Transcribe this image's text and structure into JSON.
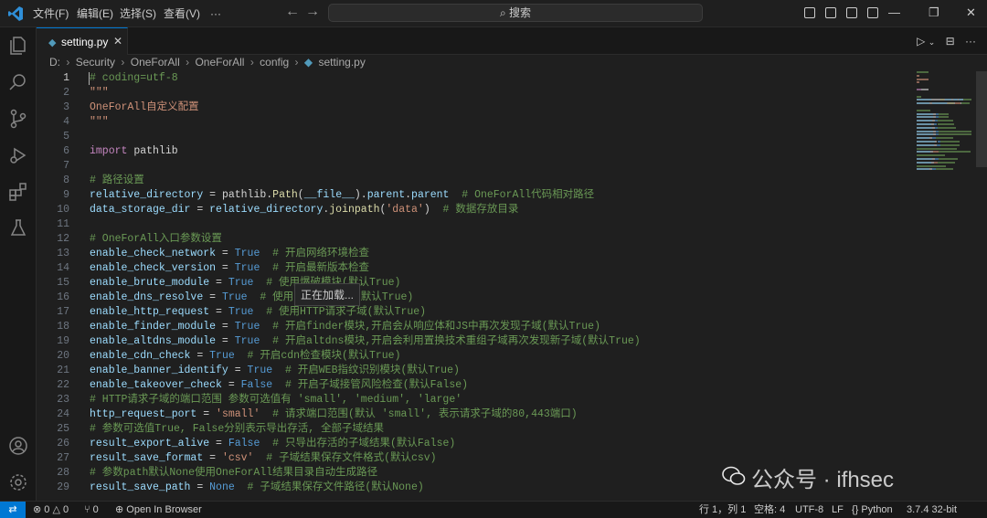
{
  "menu": [
    "文件(F)",
    "编辑(E)",
    "选择(S)",
    "查看(V)",
    "···"
  ],
  "search_label": "搜索",
  "tab": {
    "label": "setting.py",
    "close": "✕"
  },
  "breadcrumb": [
    "D:",
    "Security",
    "OneForAll",
    "OneForAll",
    "config",
    "setting.py"
  ],
  "tooltip": "正在加载...",
  "watermark": "公众号 · ifhsec",
  "status": {
    "errors": "0",
    "warnings": "0",
    "ports": "0",
    "open_browser": "Open In Browser",
    "position": "行 1，列 1",
    "spaces": "空格: 4",
    "encoding": "UTF-8",
    "eol": "LF",
    "language": "Python",
    "interpreter": "3.7.4 32-bit"
  },
  "code_lines": [
    {
      "n": "1",
      "t": [
        [
          "cm",
          "# coding=utf-8"
        ]
      ]
    },
    {
      "n": "2",
      "t": [
        [
          "str",
          "\"\"\""
        ]
      ]
    },
    {
      "n": "3",
      "t": [
        [
          "str",
          "OneForAll自定义配置"
        ]
      ]
    },
    {
      "n": "4",
      "t": [
        [
          "str",
          "\"\"\""
        ]
      ]
    },
    {
      "n": "5",
      "t": []
    },
    {
      "n": "6",
      "t": [
        [
          "kw",
          "import"
        ],
        [
          "id",
          " pathlib"
        ]
      ]
    },
    {
      "n": "7",
      "t": []
    },
    {
      "n": "8",
      "t": [
        [
          "cm",
          "# 路径设置"
        ]
      ]
    },
    {
      "n": "9",
      "t": [
        [
          "var",
          "relative_directory"
        ],
        [
          "op",
          " = "
        ],
        [
          "id",
          "pathlib"
        ],
        [
          "op",
          "."
        ],
        [
          "fn",
          "Path"
        ],
        [
          "op",
          "("
        ],
        [
          "var",
          "__file__"
        ],
        [
          "op",
          ")."
        ],
        [
          "var",
          "parent"
        ],
        [
          "op",
          "."
        ],
        [
          "var",
          "parent"
        ],
        [
          "cm",
          "  # OneForAll代码相对路径"
        ]
      ]
    },
    {
      "n": "10",
      "t": [
        [
          "var",
          "data_storage_dir"
        ],
        [
          "op",
          " = "
        ],
        [
          "var",
          "relative_directory"
        ],
        [
          "op",
          "."
        ],
        [
          "fn",
          "joinpath"
        ],
        [
          "op",
          "("
        ],
        [
          "str",
          "'data'"
        ],
        [
          "op",
          ")"
        ],
        [
          "cm",
          "  # 数据存放目录"
        ]
      ]
    },
    {
      "n": "11",
      "t": []
    },
    {
      "n": "12",
      "t": [
        [
          "cm",
          "# OneForAll入口参数设置"
        ]
      ]
    },
    {
      "n": "13",
      "t": [
        [
          "var",
          "enable_check_network"
        ],
        [
          "op",
          " = "
        ],
        [
          "bool",
          "True"
        ],
        [
          "cm",
          "  # 开启网络环境检查"
        ]
      ]
    },
    {
      "n": "14",
      "t": [
        [
          "var",
          "enable_check_version"
        ],
        [
          "op",
          " = "
        ],
        [
          "bool",
          "True"
        ],
        [
          "cm",
          "  # 开启最新版本检查"
        ]
      ]
    },
    {
      "n": "15",
      "t": [
        [
          "var",
          "enable_brute_module"
        ],
        [
          "op",
          " = "
        ],
        [
          "bool",
          "True"
        ],
        [
          "cm",
          "  # 使用爆破模块(默认True)"
        ]
      ]
    },
    {
      "n": "16",
      "t": [
        [
          "var",
          "enable_dns_resolve"
        ],
        [
          "op",
          " = "
        ],
        [
          "bool",
          "True"
        ],
        [
          "cm",
          "  # 使用DNS解析子域(默认True)"
        ]
      ]
    },
    {
      "n": "17",
      "t": [
        [
          "var",
          "enable_http_request"
        ],
        [
          "op",
          " = "
        ],
        [
          "bool",
          "True"
        ],
        [
          "cm",
          "  # 使用HTTP请求子域(默认True)"
        ]
      ]
    },
    {
      "n": "18",
      "t": [
        [
          "var",
          "enable_finder_module"
        ],
        [
          "op",
          " = "
        ],
        [
          "bool",
          "True"
        ],
        [
          "cm",
          "  # 开启finder模块,开启会从响应体和JS中再次发现子域(默认True)"
        ]
      ]
    },
    {
      "n": "19",
      "t": [
        [
          "var",
          "enable_altdns_module"
        ],
        [
          "op",
          " = "
        ],
        [
          "bool",
          "True"
        ],
        [
          "cm",
          "  # 开启altdns模块,开启会利用置换技术重组子域再次发现新子域(默认True)"
        ]
      ]
    },
    {
      "n": "20",
      "t": [
        [
          "var",
          "enable_cdn_check"
        ],
        [
          "op",
          " = "
        ],
        [
          "bool",
          "True"
        ],
        [
          "cm",
          "  # 开启cdn检查模块(默认True)"
        ]
      ]
    },
    {
      "n": "21",
      "t": [
        [
          "var",
          "enable_banner_identify"
        ],
        [
          "op",
          " = "
        ],
        [
          "bool",
          "True"
        ],
        [
          "cm",
          "  # 开启WEB指纹识别模块(默认True)"
        ]
      ]
    },
    {
      "n": "22",
      "t": [
        [
          "var",
          "enable_takeover_check"
        ],
        [
          "op",
          " = "
        ],
        [
          "bool",
          "False"
        ],
        [
          "cm",
          "  # 开启子域接管风险检查(默认False)"
        ]
      ]
    },
    {
      "n": "23",
      "t": [
        [
          "cm",
          "# HTTP请求子域的端口范围 参数可选值有 'small', 'medium', 'large'"
        ]
      ]
    },
    {
      "n": "24",
      "t": [
        [
          "var",
          "http_request_port"
        ],
        [
          "op",
          " = "
        ],
        [
          "str",
          "'small'"
        ],
        [
          "cm",
          "  # 请求端口范围(默认 'small', 表示请求子域的80,443端口)"
        ]
      ]
    },
    {
      "n": "25",
      "t": [
        [
          "cm",
          "# 参数可选值True, False分别表示导出存活, 全部子域结果"
        ]
      ]
    },
    {
      "n": "26",
      "t": [
        [
          "var",
          "result_export_alive"
        ],
        [
          "op",
          " = "
        ],
        [
          "bool",
          "False"
        ],
        [
          "cm",
          "  # 只导出存活的子域结果(默认False)"
        ]
      ]
    },
    {
      "n": "27",
      "t": [
        [
          "var",
          "result_save_format"
        ],
        [
          "op",
          " = "
        ],
        [
          "str",
          "'csv'"
        ],
        [
          "cm",
          "  # 子域结果保存文件格式(默认csv)"
        ]
      ]
    },
    {
      "n": "28",
      "t": [
        [
          "cm",
          "# 参数path默认None使用OneForAll结果目录自动生成路径"
        ]
      ]
    },
    {
      "n": "29",
      "t": [
        [
          "var",
          "result_save_path"
        ],
        [
          "op",
          " = "
        ],
        [
          "bool",
          "None"
        ],
        [
          "cm",
          "  # 子域结果保存文件路径(默认None)"
        ]
      ]
    }
  ]
}
